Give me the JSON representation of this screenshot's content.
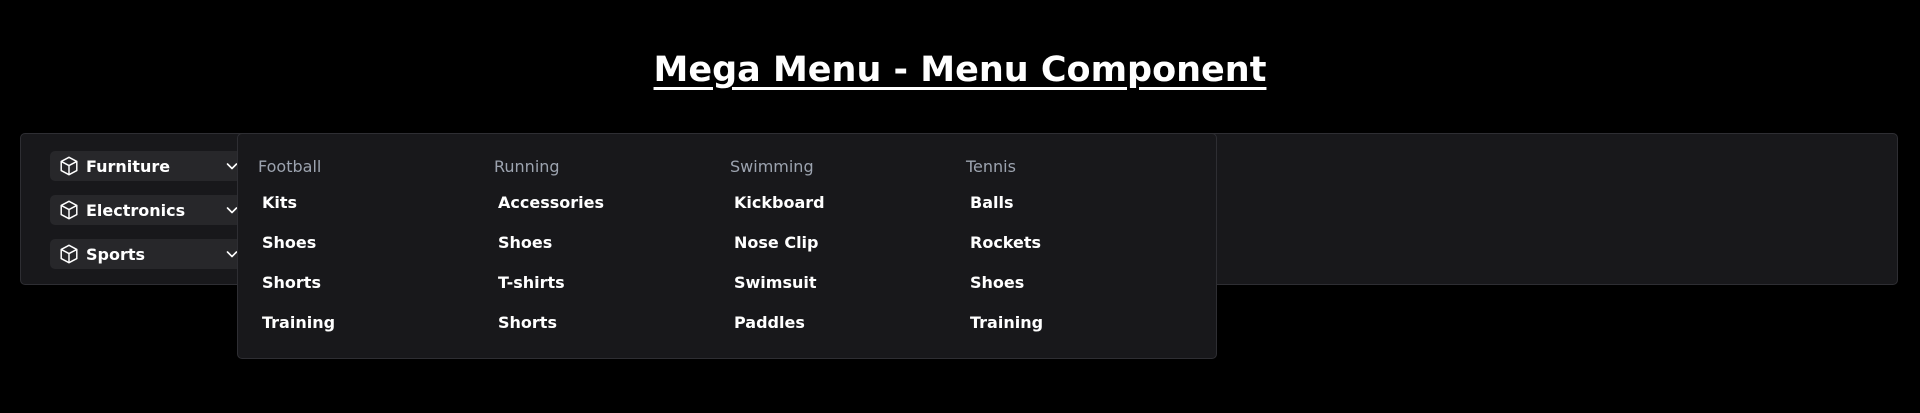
{
  "page": {
    "title": "Mega Menu - Menu Component"
  },
  "categories": [
    {
      "label": "Furniture",
      "icon": "box-icon",
      "chevron": "chevron-down-icon"
    },
    {
      "label": "Electronics",
      "icon": "box-icon",
      "chevron": "chevron-down-icon"
    },
    {
      "label": "Sports",
      "icon": "box-icon",
      "chevron": "chevron-down-icon"
    }
  ],
  "submenu": {
    "columns": [
      {
        "heading": "Football",
        "items": [
          "Kits",
          "Shoes",
          "Shorts",
          "Training"
        ]
      },
      {
        "heading": "Running",
        "items": [
          "Accessories",
          "Shoes",
          "T-shirts",
          "Shorts"
        ]
      },
      {
        "heading": "Swimming",
        "items": [
          "Kickboard",
          "Nose Clip",
          "Swimsuit",
          "Paddles"
        ]
      },
      {
        "heading": "Tennis",
        "items": [
          "Balls",
          "Rockets",
          "Shoes",
          "Training"
        ]
      }
    ]
  },
  "colors": {
    "background": "#000000",
    "panel": "#18181b",
    "category_button": "#27272a",
    "heading_text": "#9ca3af",
    "item_text": "#ffffff"
  }
}
